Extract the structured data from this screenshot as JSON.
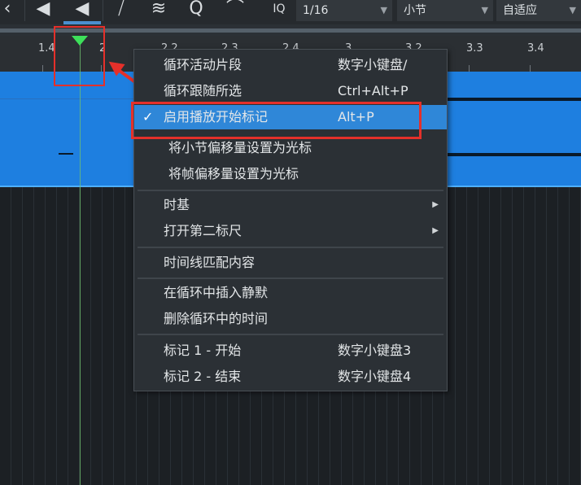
{
  "toolbar": {
    "icons": [
      "chevron-icon",
      "speaker-left-icon",
      "speaker-icon",
      "split-icon",
      "waveform-icon",
      "search-icon",
      "bend-icon"
    ],
    "iq_label": "IQ",
    "quantize_value": "1/16",
    "timebase_value": "小节",
    "zoom_value": "自适应"
  },
  "ruler": {
    "labels": [
      "1.4",
      "2",
      "2.2",
      "2.3",
      "2.4",
      "3",
      "3.2",
      "3.3",
      "3.4"
    ]
  },
  "menu": {
    "items": [
      {
        "label": "循环活动片段",
        "shortcut": "数字小键盘/"
      },
      {
        "label": "循环跟随所选",
        "shortcut": "Ctrl+Alt+P"
      },
      {
        "label": "启用播放开始标记",
        "shortcut": "Alt+P",
        "checked": "✓"
      },
      {
        "label": "将小节偏移量设置为光标",
        "shortcut": ""
      },
      {
        "label": "将帧偏移量设置为光标",
        "shortcut": ""
      },
      {
        "label": "时基",
        "shortcut": ""
      },
      {
        "label": "打开第二标尺",
        "shortcut": ""
      },
      {
        "label": "时间线匹配内容",
        "shortcut": ""
      },
      {
        "label": "在循环中插入静默",
        "shortcut": ""
      },
      {
        "label": "删除循环中的时间",
        "shortcut": ""
      },
      {
        "label": "标记 1 - 开始",
        "shortcut": "数字小键盘3"
      },
      {
        "label": "标记 2 - 结束",
        "shortcut": "数字小键盘4"
      }
    ]
  },
  "colors": {
    "highlight": "#2f87d8",
    "annotation": "#e5302a",
    "playhead": "#3de05a",
    "track": "#1e7fe0"
  }
}
